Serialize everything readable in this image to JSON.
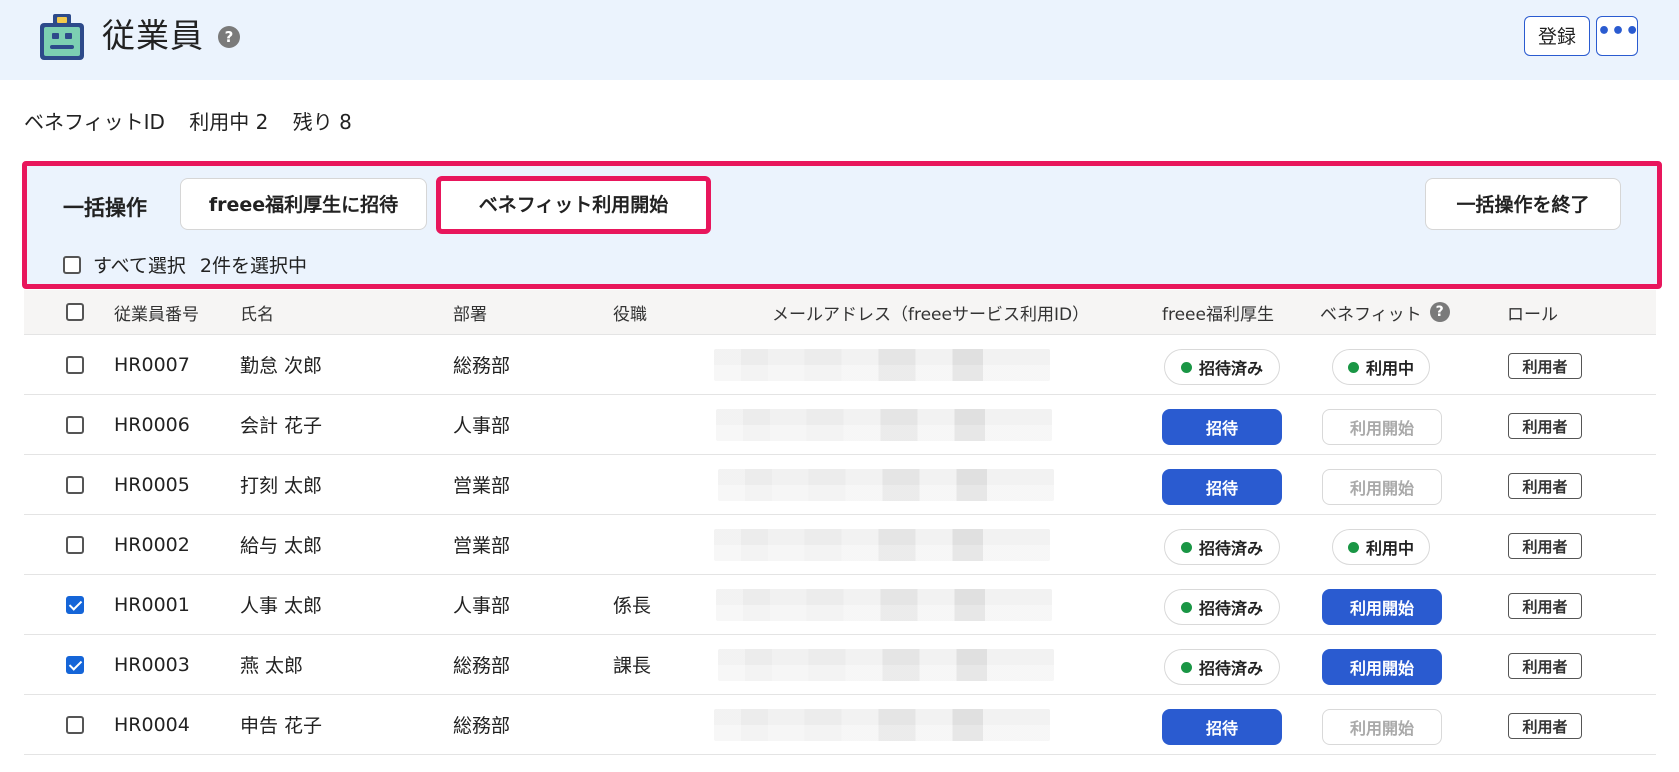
{
  "header": {
    "title": "従業員",
    "help_glyph": "?",
    "register_label": "登録",
    "more_glyph": "•••",
    "icon": "employee-id-card-icon"
  },
  "benefit_summary": {
    "label": "ベネフィットID",
    "in_use": "利用中 2",
    "remaining": "残り 8"
  },
  "bulk": {
    "title": "一括操作",
    "invite_label": "freee福利厚生に招待",
    "benefit_start_label": "ベネフィット利用開始",
    "end_label": "一括操作を終了",
    "select_all_label": "すべて選択",
    "selected_count": "2件を選択中"
  },
  "table": {
    "headers": {
      "employee_no": "従業員番号",
      "name": "氏名",
      "dept": "部署",
      "position": "役職",
      "email": "メールアドレス（freeeサービス利用ID）",
      "fukuri": "freee福利厚生",
      "benefit": "ベネフィット",
      "role": "ロール"
    },
    "rows": [
      {
        "checked": false,
        "employee_no": "HR0007",
        "name": "勤怠 次郎",
        "dept": "総務部",
        "position": "",
        "fukuri": "招待済み",
        "benefit": "利用中",
        "role": "利用者"
      },
      {
        "checked": false,
        "employee_no": "HR0006",
        "name": "会計 花子",
        "dept": "人事部",
        "position": "",
        "fukuri": "招待",
        "benefit": "利用開始",
        "role": "利用者"
      },
      {
        "checked": false,
        "employee_no": "HR0005",
        "name": "打刻 太郎",
        "dept": "営業部",
        "position": "",
        "fukuri": "招待",
        "benefit": "利用開始",
        "role": "利用者"
      },
      {
        "checked": false,
        "employee_no": "HR0002",
        "name": "給与 太郎",
        "dept": "営業部",
        "position": "",
        "fukuri": "招待済み",
        "benefit": "利用中",
        "role": "利用者"
      },
      {
        "checked": true,
        "employee_no": "HR0001",
        "name": "人事 太郎",
        "dept": "人事部",
        "position": "係長",
        "fukuri": "招待済み",
        "benefit": "利用開始",
        "role": "利用者"
      },
      {
        "checked": true,
        "employee_no": "HR0003",
        "name": "燕 太郎",
        "dept": "総務部",
        "position": "課長",
        "fukuri": "招待済み",
        "benefit": "利用開始",
        "role": "利用者"
      },
      {
        "checked": false,
        "employee_no": "HR0004",
        "name": "申告 花子",
        "dept": "総務部",
        "position": "",
        "fukuri": "招待",
        "benefit": "利用開始",
        "role": "利用者"
      }
    ]
  },
  "colors": {
    "accent_blue": "#2a5bd0",
    "highlight_pink": "#e8165c",
    "status_green": "#1a9645",
    "header_bg": "#ebf3fd"
  }
}
